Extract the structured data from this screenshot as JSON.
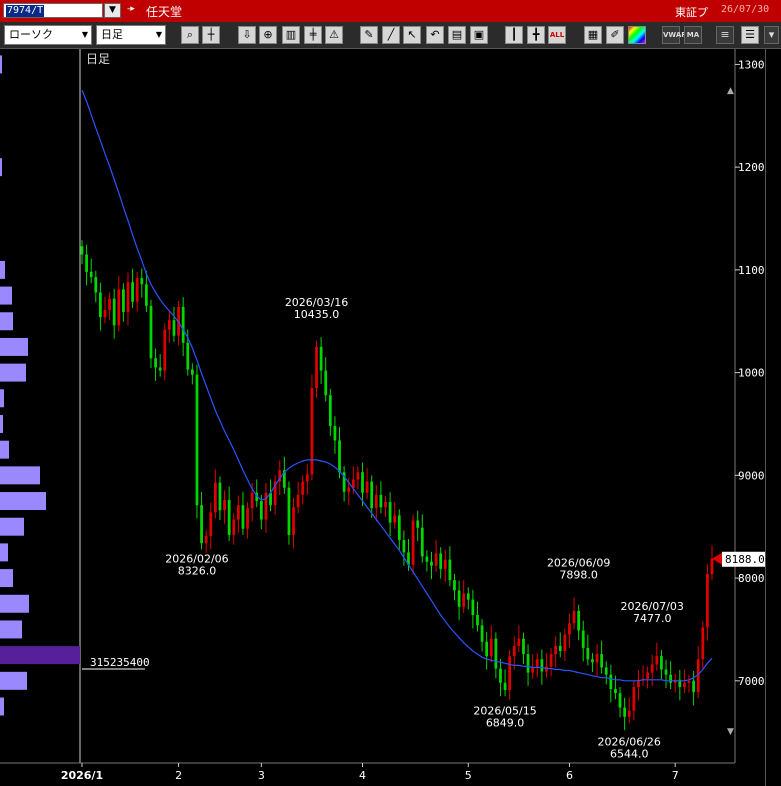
{
  "window": {
    "symbol": "7974/T",
    "company_arrows": "-▸",
    "company": "任天堂",
    "market": "東証プ",
    "date": "26/07/30"
  },
  "toolbar": {
    "chart_style": "ローソク",
    "period": "日足",
    "icons": [
      "search-icon",
      "crosshair-icon",
      "down-arrow-icon",
      "zoom-icon",
      "bar-compare-icon",
      "split-icon",
      "warning-icon",
      "pencil-icon",
      "line-tool-icon",
      "pointer-icon",
      "undo-icon",
      "memo-icon",
      "save-icon",
      "candle-icon",
      "volume-candle-icon",
      "all-icon",
      "texture-icon",
      "pen-icon",
      "color-icon",
      "vwap-icon",
      "ma-icon",
      "menu-icon",
      "list-icon",
      "settings-icon"
    ],
    "all_label": "ALL",
    "vwap_label": "VWAP",
    "ma_label": "MA"
  },
  "chart_data": {
    "type": "candlestick",
    "period_label": "日足",
    "x_labels": [
      "2026/1",
      "2",
      "3",
      "4",
      "5",
      "6",
      "7"
    ],
    "y_ticks": [
      "13000.0",
      "12000.0",
      "11000.0",
      "10000.0",
      "9000.0",
      "8000.0",
      "7000.0"
    ],
    "y_tick_values": [
      13000,
      12000,
      11000,
      10000,
      9000,
      8000,
      7000
    ],
    "ylim": [
      6200,
      13150
    ],
    "last_price": "8188.0",
    "last_price_value": 8188,
    "volume_profile_label": "315235400",
    "annotations": [
      {
        "date": "2026/03/16",
        "price": "10435.0",
        "value": 10435,
        "kind": "high",
        "day": 51
      },
      {
        "date": "2026/02/06",
        "price": "8326.0",
        "value": 8326,
        "kind": "low",
        "day": 25
      },
      {
        "date": "2026/06/09",
        "price": "7898.0",
        "value": 7898,
        "kind": "high",
        "day": 108
      },
      {
        "date": "2026/07/03",
        "price": "7477.0",
        "value": 7477,
        "kind": "high",
        "day": 124
      },
      {
        "date": "2026/05/15",
        "price": "6849.0",
        "value": 6849,
        "kind": "low",
        "day": 92
      },
      {
        "date": "2026/06/26",
        "price": "6544.0",
        "value": 6544,
        "kind": "low",
        "day": 119
      }
    ],
    "closes": [
      11150,
      10980,
      10930,
      10780,
      10540,
      10610,
      10720,
      10460,
      10810,
      10590,
      10880,
      10690,
      10920,
      10860,
      10650,
      10140,
      10050,
      10020,
      10420,
      10510,
      10360,
      10640,
      10290,
      10030,
      9980,
      8710,
      8340,
      8410,
      8640,
      8930,
      8660,
      8760,
      8420,
      8570,
      8710,
      8480,
      8680,
      8830,
      8750,
      8570,
      8830,
      8710,
      8940,
      9050,
      8880,
      8420,
      8690,
      8810,
      8940,
      9010,
      9850,
      10250,
      10020,
      9780,
      9480,
      9340,
      9030,
      8840,
      8880,
      8960,
      9030,
      8830,
      8940,
      8680,
      8810,
      8690,
      8740,
      8540,
      8610,
      8370,
      8250,
      8130,
      8560,
      8490,
      8210,
      8160,
      8120,
      8240,
      8090,
      8180,
      7980,
      7880,
      7720,
      7850,
      7790,
      7640,
      7540,
      7380,
      7240,
      7410,
      7120,
      6980,
      6910,
      7240,
      7340,
      7410,
      7260,
      7080,
      7130,
      7210,
      7090,
      7140,
      7260,
      7340,
      7290,
      7450,
      7560,
      7680,
      7490,
      7320,
      7210,
      7180,
      7260,
      7130,
      7060,
      6920,
      6880,
      6740,
      6650,
      6710,
      6940,
      7010,
      7020,
      7080,
      7160,
      7240,
      7110,
      7060,
      6980,
      7010,
      6940,
      6980,
      7000,
      6890,
      7210,
      7520,
      8040,
      8188
    ],
    "ma_values": [
      12750,
      12640,
      12510,
      12380,
      12260,
      12130,
      12010,
      11880,
      11750,
      11610,
      11480,
      11340,
      11210,
      11090,
      10960,
      10860,
      10780,
      10710,
      10650,
      10600,
      10550,
      10490,
      10420,
      10340,
      10240,
      10120,
      9990,
      9870,
      9750,
      9630,
      9530,
      9430,
      9340,
      9250,
      9150,
      9050,
      8960,
      8870,
      8800,
      8760,
      8770,
      8830,
      8900,
      8970,
      9030,
      9070,
      9100,
      9120,
      9140,
      9150,
      9150,
      9150,
      9140,
      9130,
      9110,
      9080,
      9040,
      8990,
      8930,
      8870,
      8810,
      8750,
      8690,
      8630,
      8570,
      8510,
      8450,
      8390,
      8330,
      8270,
      8200,
      8130,
      8060,
      7990,
      7920,
      7850,
      7780,
      7710,
      7640,
      7580,
      7520,
      7470,
      7420,
      7370,
      7330,
      7290,
      7260,
      7230,
      7210,
      7200,
      7190,
      7180,
      7170,
      7160,
      7150,
      7150,
      7140,
      7140,
      7130,
      7130,
      7130,
      7120,
      7120,
      7110,
      7110,
      7100,
      7100,
      7090,
      7080,
      7070,
      7060,
      7050,
      7040,
      7030,
      7030,
      7020,
      7010,
      7010,
      7000,
      7000,
      7000,
      7000,
      7010,
      7010,
      7010,
      7010,
      7010,
      7000,
      7000,
      7000,
      7000,
      7000,
      7010,
      7030,
      7060,
      7110,
      7170,
      7220
    ],
    "volume_profile": [
      {
        "price": 13000,
        "len": 2
      },
      {
        "price": 12000,
        "len": 2
      },
      {
        "price": 11000,
        "len": 5
      },
      {
        "price": 10750,
        "len": 12
      },
      {
        "price": 10500,
        "len": 13
      },
      {
        "price": 10250,
        "len": 28
      },
      {
        "price": 10000,
        "len": 26
      },
      {
        "price": 9750,
        "len": 4
      },
      {
        "price": 9500,
        "len": 3
      },
      {
        "price": 9250,
        "len": 9
      },
      {
        "price": 9000,
        "len": 40
      },
      {
        "price": 8750,
        "len": 46
      },
      {
        "price": 8500,
        "len": 24
      },
      {
        "price": 8250,
        "len": 8
      },
      {
        "price": 8000,
        "len": 13
      },
      {
        "price": 7750,
        "len": 29
      },
      {
        "price": 7500,
        "len": 22
      },
      {
        "price": 7250,
        "len": 80,
        "highlight": true
      },
      {
        "price": 7000,
        "len": 27
      },
      {
        "price": 6750,
        "len": 4
      }
    ],
    "colors": {
      "up": "#e00000",
      "down": "#00d800",
      "ma": "#2b54ff",
      "profile": "#9a88ff",
      "profile_highlight": "#55209a",
      "last_price_bg": "#ffffff",
      "last_price_marker": "#e00000"
    }
  }
}
